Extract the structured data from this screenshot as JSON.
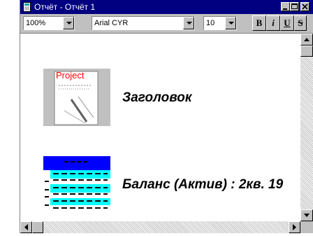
{
  "window": {
    "title": "Отчёт - Отчёт 1"
  },
  "toolbar": {
    "zoom": "100%",
    "font": "Arial CYR",
    "size": "10",
    "bold_label": "B",
    "italic_label": "i",
    "underline_label": "U",
    "strike_label": "S"
  },
  "items": [
    {
      "thumb_text": "Project",
      "label": "Заголовок"
    },
    {
      "label": "Баланс (Актив) : 2кв. 19"
    }
  ],
  "colors": {
    "titlebar": "#000080",
    "chrome": "#c0c0c0",
    "accent_cyan": "#00ffff",
    "accent_blue": "#0000ff",
    "thumb_red": "#ff0000"
  }
}
